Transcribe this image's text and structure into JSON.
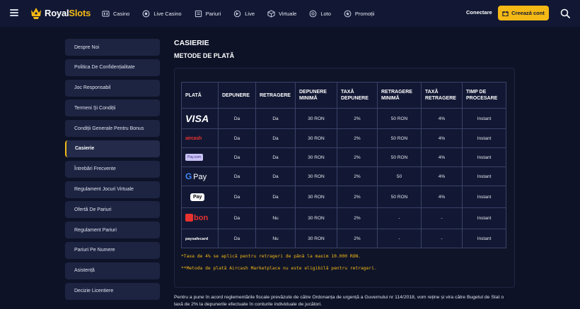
{
  "header": {
    "logo_brand": "Royal",
    "logo_suffix": "Slots",
    "nav": [
      {
        "label": "Casino",
        "icon": "casino-icon"
      },
      {
        "label": "Live Casino",
        "icon": "live-casino-icon"
      },
      {
        "label": "Pariuri",
        "icon": "sports-betting-icon"
      },
      {
        "label": "Live",
        "icon": "live-icon"
      },
      {
        "label": "Virtuale",
        "icon": "virtual-cube-icon"
      },
      {
        "label": "Loto",
        "icon": "lottery-icon"
      },
      {
        "label": "Promoții",
        "icon": "promotions-icon"
      }
    ],
    "login_label": "Conectare",
    "register_label": "Creează cont"
  },
  "sidebar": {
    "items": [
      {
        "label": "Despre Noi"
      },
      {
        "label": "Politica De Confidențialitate"
      },
      {
        "label": "Joc Responsabil"
      },
      {
        "label": "Termeni Și Condiții"
      },
      {
        "label": "Condiții Generale Pentru Bonus"
      },
      {
        "label": "Casierie",
        "active": true
      },
      {
        "label": "Întrebări Frecvente"
      },
      {
        "label": "Regulament Jocuri Virtuale"
      },
      {
        "label": "Ofertă De Pariuri"
      },
      {
        "label": "Regulament Pariuri"
      },
      {
        "label": "Pariuri Pe Numere"
      },
      {
        "label": "Asistență"
      },
      {
        "label": "Decizie Licentiere"
      }
    ]
  },
  "main": {
    "title": "CASIERIE",
    "subtitle": "METODE DE PLATĂ",
    "table": {
      "headers": [
        "PLATĂ",
        "DEPUNERE",
        "RETRAGERE",
        "DEPUNERE MINIMĂ",
        "TAXĂ DEPUNERE",
        "RETRAGERE MINIMĂ",
        "TAXĂ RETRAGERE",
        "TIMP DE PROCESARE"
      ],
      "rows": [
        {
          "method": "VISA",
          "logo_text": "VISA",
          "cells": [
            "Da",
            "Da",
            "30 RON",
            "2%",
            "50 RON",
            "4%",
            "Instant"
          ]
        },
        {
          "method": "Aircash",
          "logo_text": "aircash",
          "cells": [
            "Da",
            "Da",
            "30 RON",
            "2%",
            "50 RON",
            "4%",
            "Instant"
          ]
        },
        {
          "method": "Pay.com",
          "logo_text": "Pay.com",
          "cells": [
            "Da",
            "Da",
            "30 RON",
            "2%",
            "50 RON",
            "4%",
            "Instant"
          ]
        },
        {
          "method": "Google Pay",
          "logo_text": "Pay",
          "cells": [
            "Da",
            "Da",
            "30 RON",
            "2%",
            "50",
            "4%",
            "Instant"
          ]
        },
        {
          "method": "Apple Pay",
          "logo_text": "Pay",
          "cells": [
            "Da",
            "Da",
            "30 RON",
            "2%",
            "50 RON",
            "4%",
            "Instant"
          ]
        },
        {
          "method": "Abon",
          "logo_text": "bon",
          "cells": [
            "Da",
            "Nu",
            "30 RON",
            "2%",
            "-",
            "-",
            "Instant"
          ]
        },
        {
          "method": "paysafecard",
          "logo_text": "paysafecard",
          "cells": [
            "Da",
            "Nu",
            "30 RON",
            "2%",
            "-",
            "-",
            "Instant"
          ]
        }
      ]
    },
    "note1": "*Taxa de 4% se aplică pentru retrageri de până la maxim 10.000 RON.",
    "note2": "**Metoda de plată Aircash Marketplace nu este eligibilă pentru retrageri.",
    "paragraph": "Pentru a pune în acord reglementările fiscale prevăzute de către Ordonanța de urgență a Guvernului nr 114/2018, vom reține și vira către Bugetul de Stat o taxă de 2% la depunerile efectuate în conturile individuale de jucători."
  },
  "colors": {
    "background": "#0d1226",
    "header": "#121834",
    "accent": "#f5b915",
    "sidebar_item": "#1d2442",
    "table_border": "#3a4266",
    "visa_blue": "#ffffff",
    "aircash_red": "#e8322f",
    "abon_red": "#e8322f"
  }
}
